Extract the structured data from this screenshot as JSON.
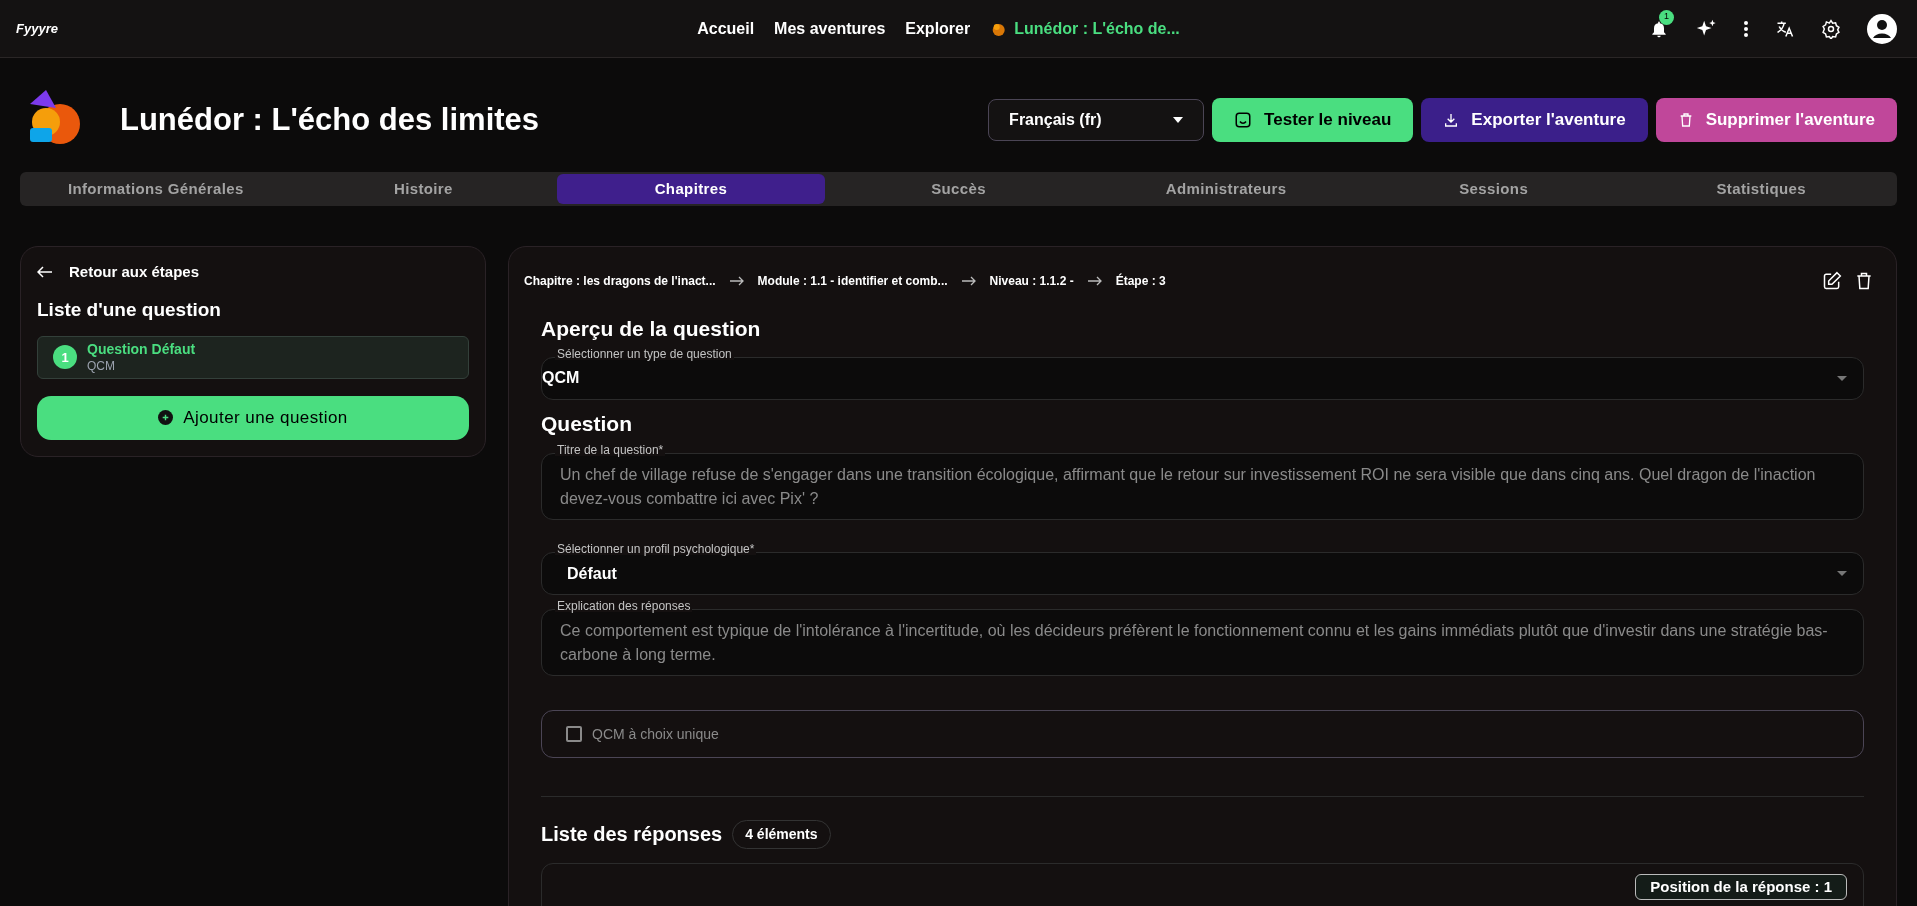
{
  "topbar": {
    "logo": "Fyyyre",
    "nav": [
      {
        "label": "Accueil",
        "selected": false
      },
      {
        "label": "Mes aventures",
        "selected": false
      },
      {
        "label": "Explorer",
        "selected": false
      },
      {
        "label": "Lunédor : L'écho de...",
        "selected": true
      }
    ],
    "notification_count": "1"
  },
  "header": {
    "title": "Lunédor : L'écho des limites",
    "language": "Français (fr)",
    "buttons": [
      {
        "label": "Tester le niveau",
        "kind": "test"
      },
      {
        "label": "Exporter l'aventure",
        "kind": "export"
      },
      {
        "label": "Supprimer l'aventure",
        "kind": "delete"
      }
    ]
  },
  "tabs": [
    {
      "label": "Informations Générales",
      "selected": false
    },
    {
      "label": "Histoire",
      "selected": false
    },
    {
      "label": "Chapitres",
      "selected": true
    },
    {
      "label": "Succès",
      "selected": false
    },
    {
      "label": "Administrateurs",
      "selected": false
    },
    {
      "label": "Sessions",
      "selected": false
    },
    {
      "label": "Statistiques",
      "selected": false
    }
  ],
  "sidebar": {
    "back": "Retour aux étapes",
    "title": "Liste d'une question",
    "questions": [
      {
        "number": "1",
        "title": "Question Défaut",
        "type": "QCM",
        "selected": true
      }
    ],
    "add_button": "Ajouter une question"
  },
  "main": {
    "breadcrumb": [
      "Chapitre : les dragons de l'inact...",
      "Module : 1.1 - identifier et comb...",
      "Niveau : 1.1.2 -",
      "Étape : 3"
    ],
    "preview_title": "Aperçu de la question",
    "type_select": {
      "label": "Sélectionner un type de question",
      "value": "QCM"
    },
    "question_heading": "Question",
    "title_field": {
      "label": "Titre de la question*",
      "value": "Un chef de village refuse de s'engager dans une transition écologique, affirmant que le retour sur investissement ROI ne sera visible que dans cinq ans. Quel dragon de l'inaction devez-vous combattre ici avec Pix' ?"
    },
    "profile_select": {
      "label": "Sélectionner un profil psychologique*",
      "value": "Défaut"
    },
    "explanation_field": {
      "label": "Explication des réponses",
      "value": "Ce comportement est typique de l'intolérance à l'incertitude, où les décideurs préfèrent le fonctionnement connu et les gains immédiats plutôt que d'investir dans une stratégie bas-carbone à long terme."
    },
    "single_choice": {
      "label": "QCM à choix unique",
      "checked": false
    },
    "answers_title": "Liste des réponses",
    "answers_count": "4 éléments",
    "answer_position": "Position de la réponse : 1"
  }
}
